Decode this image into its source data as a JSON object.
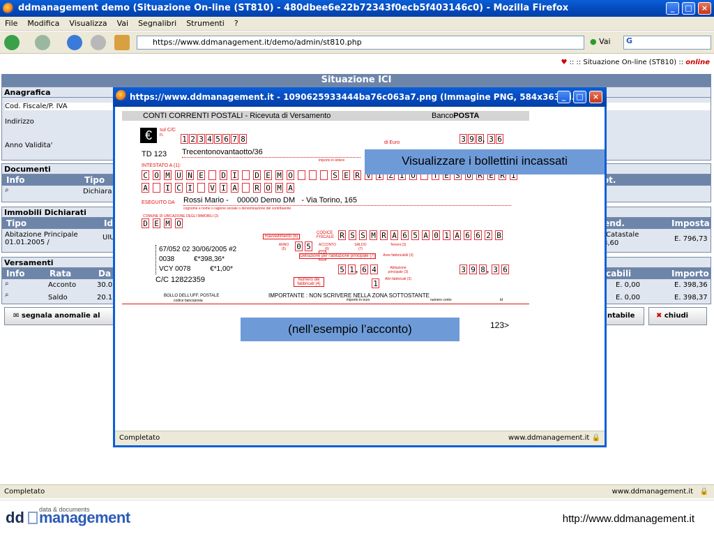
{
  "window": {
    "title": "ddmanagement demo (Situazione On-line (ST810) - 480dbee6e22b72343f0ecb5f403146c0) - Mozilla Firefox"
  },
  "menu": [
    "File",
    "Modifica",
    "Visualizza",
    "Vai",
    "Segnalibri",
    "Strumenti",
    "?"
  ],
  "toolbar": {
    "url": "https://www.ddmanagement.it/demo/admin/st810.php",
    "go_label": "Vai",
    "google": "G"
  },
  "page": {
    "crumb_prefix": ":: :: Situazione On-line (ST810) ::",
    "crumb_status": "online",
    "banner": "Situazione ICI",
    "anagrafica": {
      "title": "Anagrafica",
      "fields": [
        "Cod. Fiscale/P. IVA",
        "Indirizzo",
        "Anno Validita'"
      ]
    },
    "documenti": {
      "title": "Documenti",
      "cols": [
        "Info",
        "Tipo"
      ],
      "row_tipo": "Dichiara",
      "right_col": "rot."
    },
    "immobili": {
      "title": "Immobili Dichiarati",
      "cols": [
        "Tipo",
        "Id"
      ],
      "row_tipo": "Abitazione Principale 01.01.2005 /",
      "row_id": "UIU",
      "right_cols": [
        "cend.",
        "Imposta"
      ],
      "right_cat": "Catastale",
      "right_val": "8,60",
      "imposta": "E. 796,73"
    },
    "versamenti": {
      "title": "Versamenti",
      "cols": [
        "Info",
        "Rata",
        "Da"
      ],
      "rows": [
        {
          "rata": "Acconto",
          "data": "30.0",
          "imp": "E. 398,36",
          "right": "E. 0,00"
        },
        {
          "rata": "Saldo",
          "data": "20.1",
          "imp": "E. 398,37",
          "right": "E. 0,00"
        }
      ],
      "right_cols": [
        "ricabili",
        "Importo"
      ]
    },
    "btn_segnala": "segnala anomalie al",
    "btn_contabile": "ntabile",
    "btn_chiudi": "chiudi"
  },
  "popup": {
    "title": "https://www.ddmanagement.it - 1090625933444ba76c063a7.png (Immagine PNG, 584x363 pi...",
    "status": "Completato",
    "status_right": "www.ddmanagement.it",
    "form": {
      "header_left": "CONTI CORRENTI POSTALI - Ricevuta di Versamento",
      "header_right_a": "Banco",
      "header_right_b": "POSTA",
      "euro": "€",
      "sul_cc": "sul C/C n.",
      "cc_digits": [
        "1",
        "2",
        "3",
        "4",
        "5",
        "6",
        "7",
        "8"
      ],
      "di_euro": "di Euro",
      "amount": [
        "3",
        "9",
        "8",
        ",",
        "3",
        "6"
      ],
      "td": "TD 123",
      "amount_words": "Trecentonovantaotto/36",
      "importo_lettere": "importo in lettere",
      "intestato": "INTESTATO A (1):",
      "row1": [
        "C",
        "O",
        "M",
        "U",
        "N",
        "E",
        "",
        "D",
        "I",
        "",
        "D",
        "E",
        "M",
        "O",
        "",
        "",
        "",
        "S",
        "E",
        "R",
        "V",
        "I",
        "Z",
        "I",
        "O",
        "",
        "T",
        "E",
        "S",
        "O",
        "R",
        "E",
        "R",
        "I"
      ],
      "row2": [
        "A",
        "",
        "I",
        "C",
        "I",
        "",
        "V",
        "I",
        "A",
        "",
        "R",
        "O",
        "M",
        "A"
      ],
      "eseguito": "ESEGUITO DA",
      "eseguito_val": "Rossi Mario -    00000 Demo DM   - Via Torino, 165",
      "eseguito_hint": "cognome e nome o ragione sociale o denominazione del contribuente",
      "comune_label": "COMUNE DI UBICAZIONE DEGLI IMMOBILI (2)",
      "comune_val": [
        "D",
        "E",
        "M",
        "O"
      ],
      "ravvedimento": "Ravvedimento (6)",
      "cf_label": "CODICE FISCALE",
      "cf": [
        "R",
        "S",
        "S",
        "M",
        "R",
        "A",
        "6",
        "5",
        "A",
        "0",
        "1",
        "A",
        "6",
        "6",
        "2",
        "B"
      ],
      "anno_label": "ANNO (5)",
      "anno": [
        "0",
        "5"
      ],
      "acconto_label": "ACCONTO (6)",
      "acconto": "X",
      "saldo_label": "SALDO (7)",
      "terreni": "Terreni (3)",
      "detrazione": "Detrazione per l'abitazione principale (7)",
      "aree": "Aree fabbricabili (3)",
      "stamp_lines": [
        "67/052   02  30/06/2005 #2",
        "0038          €*398,36*",
        "VCY 0078          €*1,00*"
      ],
      "cc_line": "C/C 12822359",
      "ab_digits": [
        "5",
        "1",
        ",",
        "6",
        "4"
      ],
      "ab_label": "Abitazione principale (3)",
      "total": [
        "3",
        "9",
        "8",
        ",",
        "3",
        "6"
      ],
      "num_fab": "Numero dei fabbricati (4)",
      "num_fab_val": "1",
      "altri": "Altri fabbricati (3)",
      "bollo": "BOLLO DELL'UFF. POSTALE",
      "bollo_sub": "codice bancoposta",
      "importante": "IMPORTANTE : NON SCRIVERE NELLA ZONA SOTTOSTANTE",
      "importo_euro": "importo in euro",
      "numero_conto": "numero conto",
      "td_small": "td",
      "code": "123>"
    },
    "callout_top": "Visualizzare i bollettini incassati",
    "callout_mid": "(nell’esempio l’acconto)"
  },
  "status": {
    "left": "Completato",
    "right": "www.ddmanagement.it"
  },
  "footer": {
    "logo_dd": "dd",
    "logo_tag": "data & documents",
    "logo_mg": "management",
    "url": "http://www.ddmanagement.it"
  }
}
